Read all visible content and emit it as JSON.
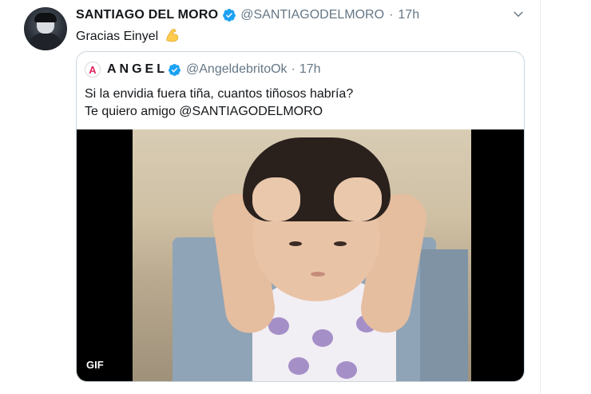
{
  "tweet": {
    "author_name": "SANTIAGO DEL MORO",
    "handle": "@SANTIAGODELMORO",
    "separator": "·",
    "time": "17h",
    "text": "Gracias Einyel",
    "emoji": "flexed-biceps-emoji"
  },
  "quoted_tweet": {
    "avatar_letter": "A",
    "author_name": "ANGEL",
    "handle": "@AngeldebritoOk",
    "separator": "·",
    "time": "17h",
    "text_line_1": "Si la envidia fuera tiña, cuantos tiñosos habría?",
    "text_line_2": "Te quiero amigo @SANTIAGODELMORO",
    "media": {
      "type": "gif",
      "badge": "GIF"
    }
  },
  "colors": {
    "verified": "#1da1f2",
    "secondary_text": "#657786",
    "border": "#ccd6dd"
  },
  "icons": [
    "verified-badge-icon",
    "chevron-down-icon"
  ]
}
